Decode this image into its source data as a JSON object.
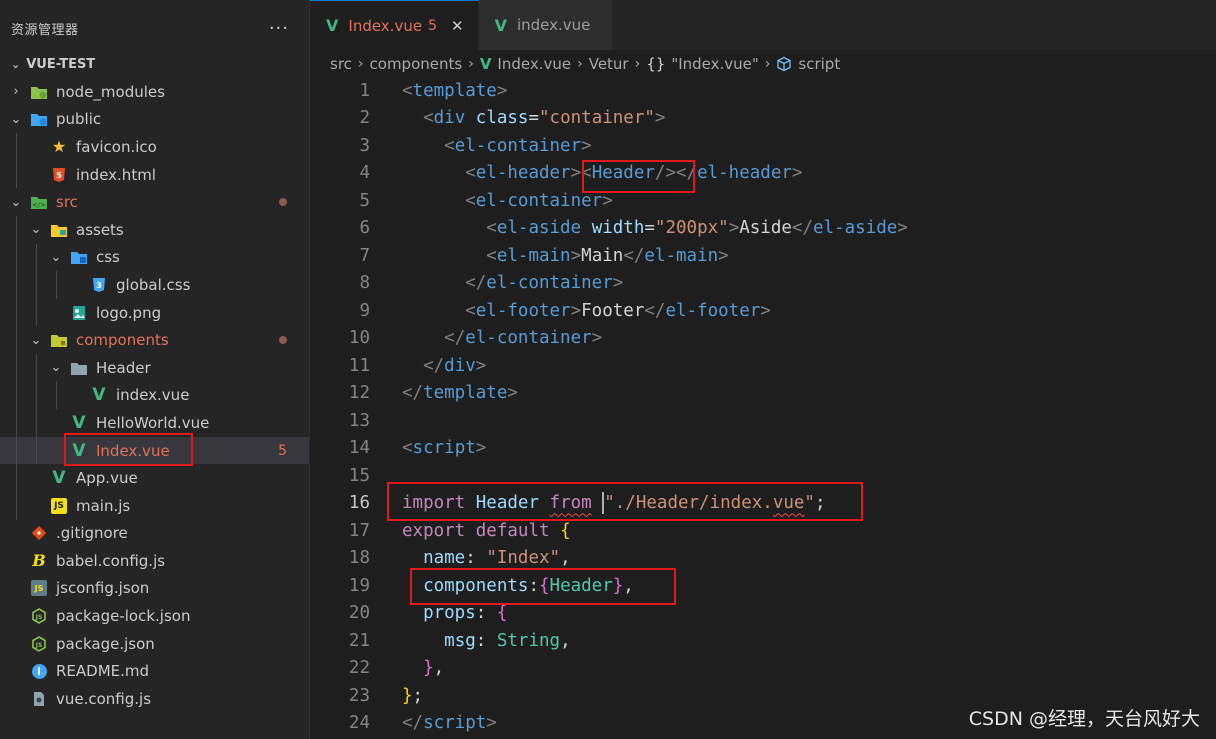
{
  "explorer": {
    "title": "资源管理器",
    "more": "···",
    "root": "VUE-TEST",
    "items": [
      {
        "label": "node_modules",
        "depth": 0,
        "chev": "›",
        "icon": "folder-node-icon",
        "modified": false
      },
      {
        "label": "public",
        "depth": 0,
        "chev": "⌄",
        "icon": "folder-public-icon",
        "modified": false
      },
      {
        "label": "favicon.ico",
        "depth": 1,
        "chev": "",
        "icon": "star-icon",
        "modified": false
      },
      {
        "label": "index.html",
        "depth": 1,
        "chev": "",
        "icon": "html5-icon",
        "modified": false
      },
      {
        "label": "src",
        "depth": 0,
        "chev": "⌄",
        "icon": "folder-src-icon",
        "modified": true,
        "dot": true
      },
      {
        "label": "assets",
        "depth": 1,
        "chev": "⌄",
        "icon": "folder-assets-icon",
        "modified": false
      },
      {
        "label": "css",
        "depth": 2,
        "chev": "⌄",
        "icon": "folder-css-icon",
        "modified": false
      },
      {
        "label": "global.css",
        "depth": 3,
        "chev": "",
        "icon": "css3-icon",
        "modified": false
      },
      {
        "label": "logo.png",
        "depth": 2,
        "chev": "",
        "icon": "image-icon",
        "modified": false
      },
      {
        "label": "components",
        "depth": 1,
        "chev": "⌄",
        "icon": "folder-components-icon",
        "modified": true,
        "dot": true
      },
      {
        "label": "Header",
        "depth": 2,
        "chev": "⌄",
        "icon": "folder-plain-icon",
        "modified": false
      },
      {
        "label": "index.vue",
        "depth": 3,
        "chev": "",
        "icon": "vue-icon",
        "modified": false
      },
      {
        "label": "HelloWorld.vue",
        "depth": 2,
        "chev": "",
        "icon": "vue-icon",
        "modified": false
      },
      {
        "label": "Index.vue",
        "depth": 2,
        "chev": "",
        "icon": "vue-icon",
        "modified": true,
        "badge": "5",
        "active": true
      },
      {
        "label": "App.vue",
        "depth": 1,
        "chev": "",
        "icon": "vue-icon",
        "modified": false
      },
      {
        "label": "main.js",
        "depth": 1,
        "chev": "",
        "icon": "js-icon",
        "modified": false
      },
      {
        "label": ".gitignore",
        "depth": 0,
        "chev": "",
        "icon": "git-icon",
        "modified": false
      },
      {
        "label": "babel.config.js",
        "depth": 0,
        "chev": "",
        "icon": "babel-icon",
        "modified": false
      },
      {
        "label": "jsconfig.json",
        "depth": 0,
        "chev": "",
        "icon": "json-js-icon",
        "modified": false
      },
      {
        "label": "package-lock.json",
        "depth": 0,
        "chev": "",
        "icon": "nodejs-icon",
        "modified": false
      },
      {
        "label": "package.json",
        "depth": 0,
        "chev": "",
        "icon": "nodejs-icon",
        "modified": false
      },
      {
        "label": "README.md",
        "depth": 0,
        "chev": "",
        "icon": "info-icon",
        "modified": false
      },
      {
        "label": "vue.config.js",
        "depth": 0,
        "chev": "",
        "icon": "config-icon",
        "modified": false
      }
    ]
  },
  "tabs": [
    {
      "label": "Index.vue",
      "count": "5",
      "close": "✕",
      "active": true
    },
    {
      "label": "index.vue",
      "active": false
    }
  ],
  "breadcrumb": {
    "items": [
      "src",
      "components",
      "Index.vue",
      "Vetur",
      "\"Index.vue\"",
      "script"
    ],
    "icons": [
      "",
      "",
      "vue-icon",
      "",
      "braces-icon",
      "cube-icon"
    ],
    "braces": "{}",
    "sep": "›"
  },
  "code": {
    "current_line": 16,
    "lines": [
      {
        "n": "1",
        "t": [
          [
            "tk-br",
            "<"
          ],
          [
            "tk-tag",
            "template"
          ],
          [
            "tk-br",
            ">"
          ]
        ]
      },
      {
        "n": "2",
        "t": [
          [
            "tk-txt",
            "  "
          ],
          [
            "tk-br",
            "<"
          ],
          [
            "tk-tag",
            "div"
          ],
          [
            "tk-txt",
            " "
          ],
          [
            "tk-attr",
            "class"
          ],
          [
            "tk-txt",
            "="
          ],
          [
            "tk-str",
            "\"container\""
          ],
          [
            "tk-br",
            ">"
          ]
        ]
      },
      {
        "n": "3",
        "t": [
          [
            "tk-txt",
            "    "
          ],
          [
            "tk-br",
            "<"
          ],
          [
            "tk-tag",
            "el-container"
          ],
          [
            "tk-br",
            ">"
          ]
        ]
      },
      {
        "n": "4",
        "t": [
          [
            "tk-txt",
            "      "
          ],
          [
            "tk-br",
            "<"
          ],
          [
            "tk-tag",
            "el-header"
          ],
          [
            "tk-br",
            ">"
          ],
          [
            "tk-br",
            "<"
          ],
          [
            "tk-tag",
            "Header"
          ],
          [
            "tk-br",
            "/>"
          ],
          [
            "tk-br",
            "</"
          ],
          [
            "tk-tag",
            "el-header"
          ],
          [
            "tk-br",
            ">"
          ]
        ]
      },
      {
        "n": "5",
        "t": [
          [
            "tk-txt",
            "      "
          ],
          [
            "tk-br",
            "<"
          ],
          [
            "tk-tag",
            "el-container"
          ],
          [
            "tk-br",
            ">"
          ]
        ]
      },
      {
        "n": "6",
        "t": [
          [
            "tk-txt",
            "        "
          ],
          [
            "tk-br",
            "<"
          ],
          [
            "tk-tag",
            "el-aside"
          ],
          [
            "tk-txt",
            " "
          ],
          [
            "tk-attr",
            "width"
          ],
          [
            "tk-txt",
            "="
          ],
          [
            "tk-str",
            "\"200px\""
          ],
          [
            "tk-br",
            ">"
          ],
          [
            "tk-txt",
            "Aside"
          ],
          [
            "tk-br",
            "</"
          ],
          [
            "tk-tag",
            "el-aside"
          ],
          [
            "tk-br",
            ">"
          ]
        ]
      },
      {
        "n": "7",
        "t": [
          [
            "tk-txt",
            "        "
          ],
          [
            "tk-br",
            "<"
          ],
          [
            "tk-tag",
            "el-main"
          ],
          [
            "tk-br",
            ">"
          ],
          [
            "tk-txt",
            "Main"
          ],
          [
            "tk-br",
            "</"
          ],
          [
            "tk-tag",
            "el-main"
          ],
          [
            "tk-br",
            ">"
          ]
        ]
      },
      {
        "n": "8",
        "t": [
          [
            "tk-txt",
            "      "
          ],
          [
            "tk-br",
            "</"
          ],
          [
            "tk-tag",
            "el-container"
          ],
          [
            "tk-br",
            ">"
          ]
        ]
      },
      {
        "n": "9",
        "t": [
          [
            "tk-txt",
            "      "
          ],
          [
            "tk-br",
            "<"
          ],
          [
            "tk-tag",
            "el-footer"
          ],
          [
            "tk-br",
            ">"
          ],
          [
            "tk-txt",
            "Footer"
          ],
          [
            "tk-br",
            "</"
          ],
          [
            "tk-tag",
            "el-footer"
          ],
          [
            "tk-br",
            ">"
          ]
        ]
      },
      {
        "n": "10",
        "t": [
          [
            "tk-txt",
            "    "
          ],
          [
            "tk-br",
            "</"
          ],
          [
            "tk-tag",
            "el-container"
          ],
          [
            "tk-br",
            ">"
          ]
        ]
      },
      {
        "n": "11",
        "t": [
          [
            "tk-txt",
            "  "
          ],
          [
            "tk-br",
            "</"
          ],
          [
            "tk-tag",
            "div"
          ],
          [
            "tk-br",
            ">"
          ]
        ]
      },
      {
        "n": "12",
        "t": [
          [
            "tk-br",
            "</"
          ],
          [
            "tk-tag",
            "template"
          ],
          [
            "tk-br",
            ">"
          ]
        ]
      },
      {
        "n": "13",
        "t": []
      },
      {
        "n": "14",
        "t": [
          [
            "tk-br",
            "<"
          ],
          [
            "tk-tag",
            "script"
          ],
          [
            "tk-br",
            ">"
          ]
        ]
      },
      {
        "n": "15",
        "t": []
      },
      {
        "n": "16",
        "t": [
          [
            "tk-kw",
            "import"
          ],
          [
            "tk-txt",
            " "
          ],
          [
            "tk-var",
            "Header"
          ],
          [
            "tk-txt",
            " "
          ],
          [
            "tk-kw squig",
            "from"
          ],
          [
            "tk-txt",
            " "
          ],
          [
            "cursor",
            ""
          ],
          [
            "tk-str",
            "\"./Header/index."
          ],
          [
            "tk-str squig",
            "vue"
          ],
          [
            "tk-str",
            "\""
          ],
          [
            "tk-txt",
            ";"
          ]
        ]
      },
      {
        "n": "17",
        "t": [
          [
            "tk-kw",
            "export"
          ],
          [
            "tk-txt",
            " "
          ],
          [
            "tk-kw",
            "default"
          ],
          [
            "tk-txt",
            " "
          ],
          [
            "tk-y",
            "{"
          ]
        ]
      },
      {
        "n": "18",
        "t": [
          [
            "tk-txt",
            "  "
          ],
          [
            "tk-var",
            "name"
          ],
          [
            "tk-txt",
            ": "
          ],
          [
            "tk-str",
            "\"Index\""
          ],
          [
            "tk-txt",
            ","
          ]
        ]
      },
      {
        "n": "19",
        "t": [
          [
            "tk-txt",
            "  "
          ],
          [
            "tk-var",
            "components"
          ],
          [
            "tk-txt",
            ":"
          ],
          [
            "tk-p",
            "{"
          ],
          [
            "tk-type",
            "Header"
          ],
          [
            "tk-p",
            "}"
          ],
          [
            "tk-txt",
            ","
          ]
        ]
      },
      {
        "n": "20",
        "t": [
          [
            "tk-txt",
            "  "
          ],
          [
            "tk-var",
            "props"
          ],
          [
            "tk-txt",
            ": "
          ],
          [
            "tk-p",
            "{"
          ]
        ]
      },
      {
        "n": "21",
        "t": [
          [
            "tk-txt",
            "    "
          ],
          [
            "tk-var",
            "msg"
          ],
          [
            "tk-txt",
            ": "
          ],
          [
            "tk-type",
            "String"
          ],
          [
            "tk-txt",
            ","
          ]
        ]
      },
      {
        "n": "22",
        "t": [
          [
            "tk-txt",
            "  "
          ],
          [
            "tk-p",
            "}"
          ],
          [
            "tk-txt",
            ","
          ]
        ]
      },
      {
        "n": "23",
        "t": [
          [
            "tk-y",
            "}"
          ],
          [
            "tk-txt",
            ";"
          ]
        ]
      },
      {
        "n": "24",
        "t": [
          [
            "tk-br",
            "</"
          ],
          [
            "tk-tag",
            "script"
          ],
          [
            "tk-br",
            ">"
          ]
        ]
      }
    ]
  },
  "watermark": "CSDN @经理，天台风好大",
  "colors": {
    "accent": "#007acc",
    "modified": "#e2735a",
    "highlight_box": "#e0191c",
    "vue_green": "#41b883"
  }
}
